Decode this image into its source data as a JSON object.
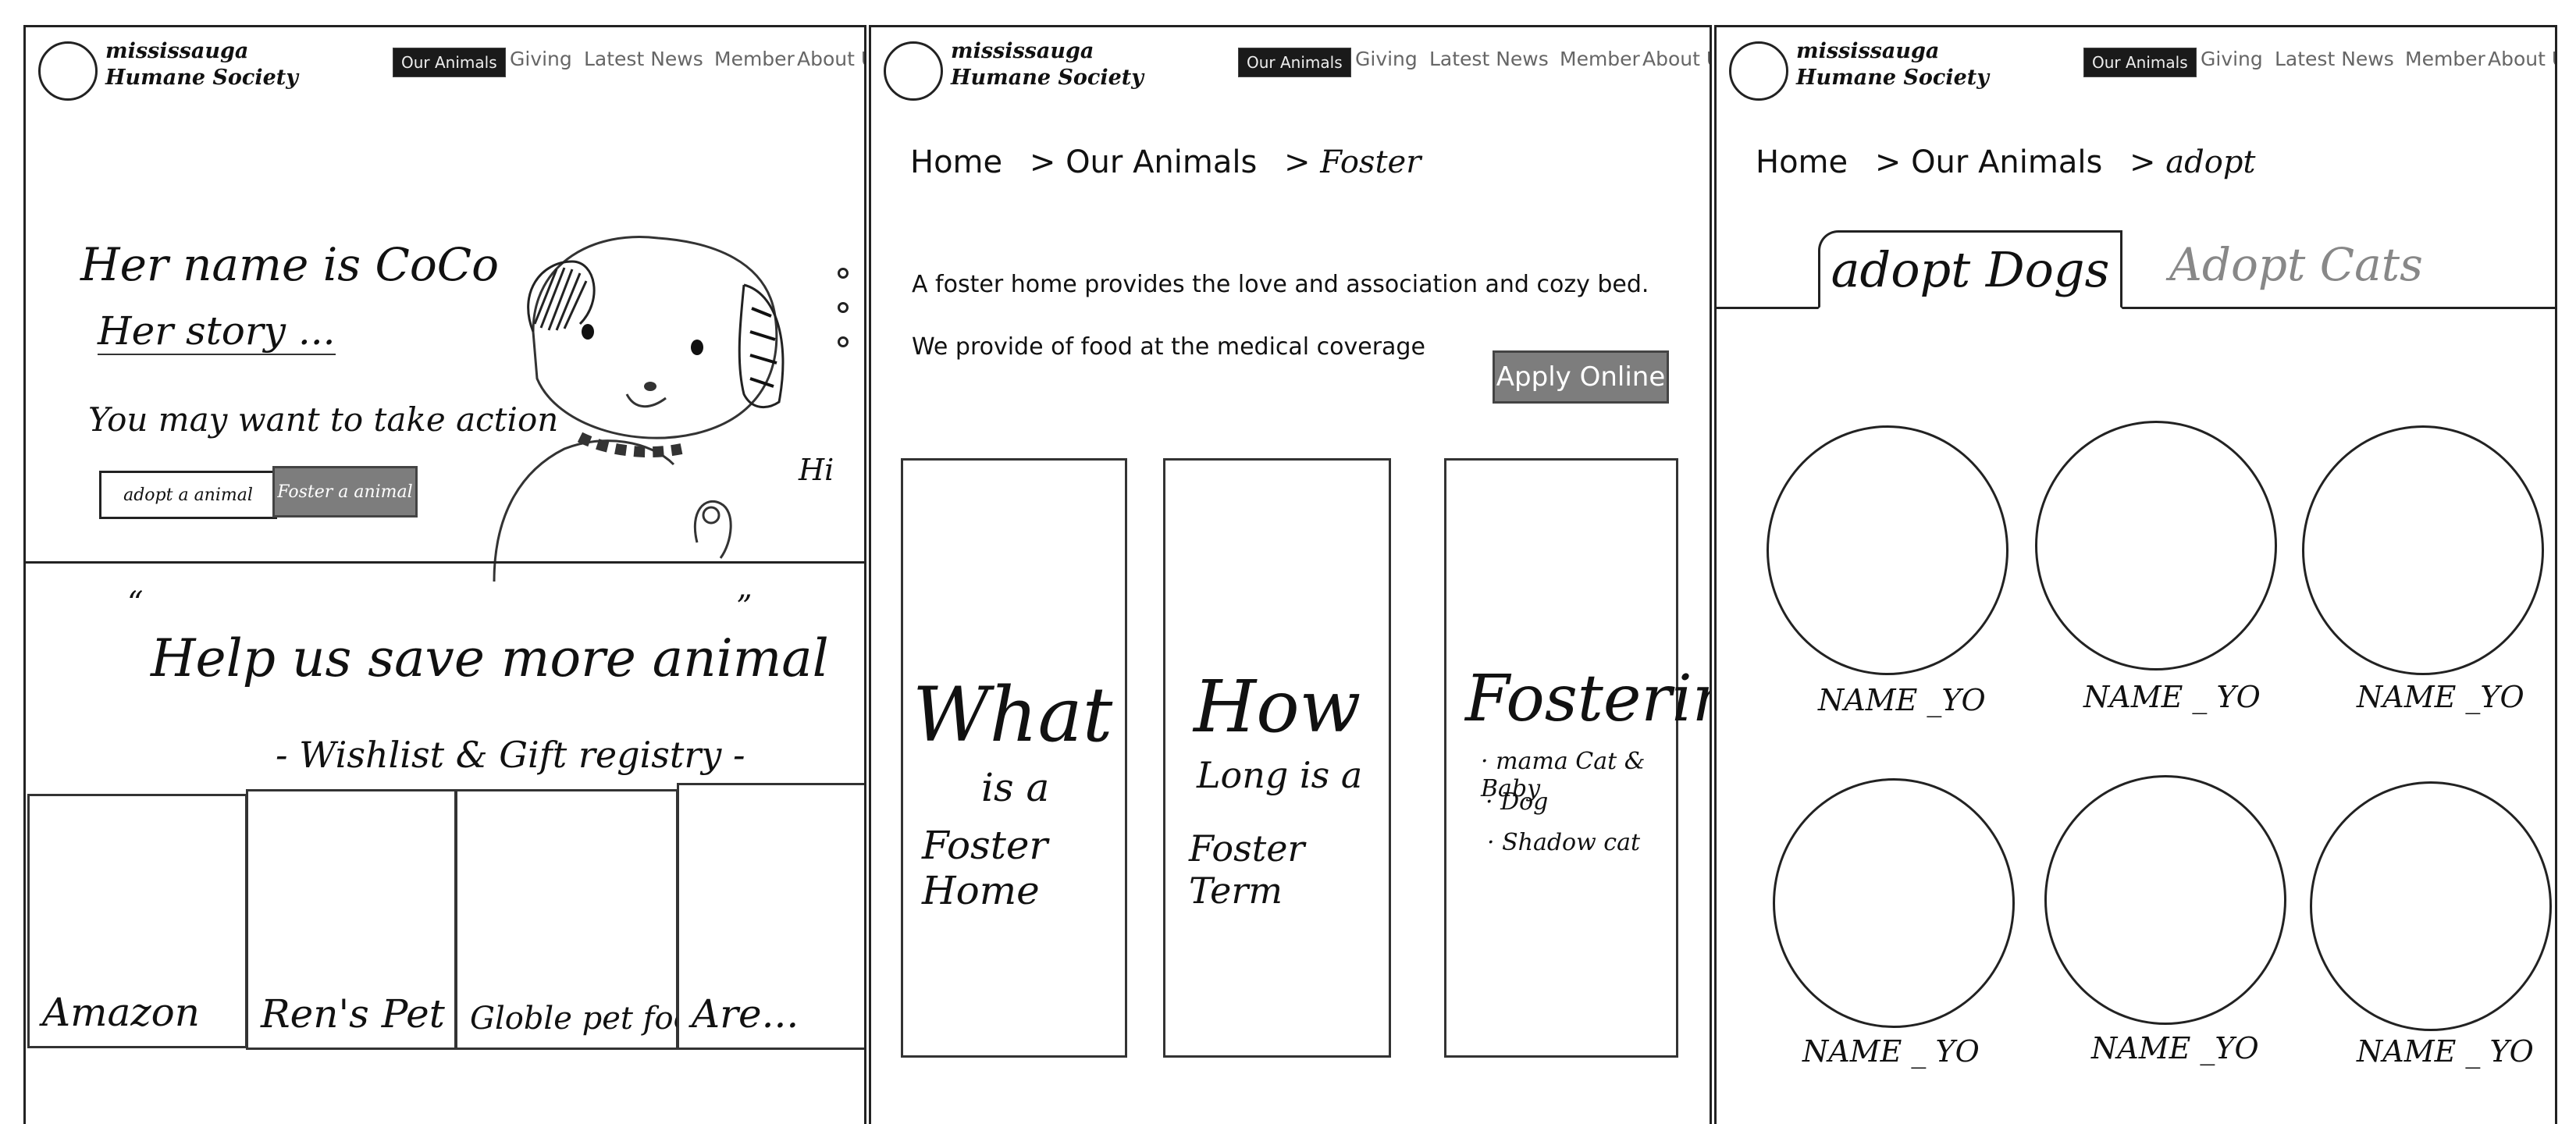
{
  "brand": {
    "line1": "mississauga",
    "line2": "Humane Society"
  },
  "nav": {
    "our_animals": "Our Animals",
    "giving": "Giving",
    "latest_news": "Latest News",
    "member": "Member",
    "about_us": "About Us"
  },
  "home": {
    "headline": "Her name is CoCo",
    "story": "Her story ...",
    "cta_text": "You may want to take action",
    "adopt_button": "adopt a animal",
    "foster_button": "Foster a animal",
    "hi": "Hi",
    "open_quote": "“",
    "close_quote": "”",
    "help_title": "Help us save more animal",
    "wishlist": "- Wishlist & Gift registry -",
    "wishlist_items": [
      "Amazon",
      "Ren's Pet",
      "Globle pet food",
      "Are..."
    ]
  },
  "foster": {
    "breadcrumb": [
      "Home",
      "> Our Animals",
      "> Foster"
    ],
    "intro1": "A foster home provides the love and association and cozy bed.",
    "intro2": "We provide of food at the medical coverage",
    "apply_button": "Apply Online",
    "cards": [
      {
        "title": "What",
        "line1": "is a",
        "line2": "Foster Home"
      },
      {
        "title": "How",
        "line1": "Long is a",
        "line2": "Foster Term"
      },
      {
        "title": "Fostering",
        "items": [
          "· mama Cat & Baby",
          "· Dog",
          "· Shadow cat"
        ]
      }
    ]
  },
  "adopt": {
    "breadcrumb": [
      "Home",
      "> Our Animals",
      "> adopt"
    ],
    "tab_dogs": "adopt Dogs",
    "tab_cats": "Adopt Cats",
    "animals": [
      "NAME _YO",
      "NAME _ YO",
      "NAME _YO",
      "NAME _ YO",
      "NAME _YO",
      "NAME _ YO"
    ]
  }
}
